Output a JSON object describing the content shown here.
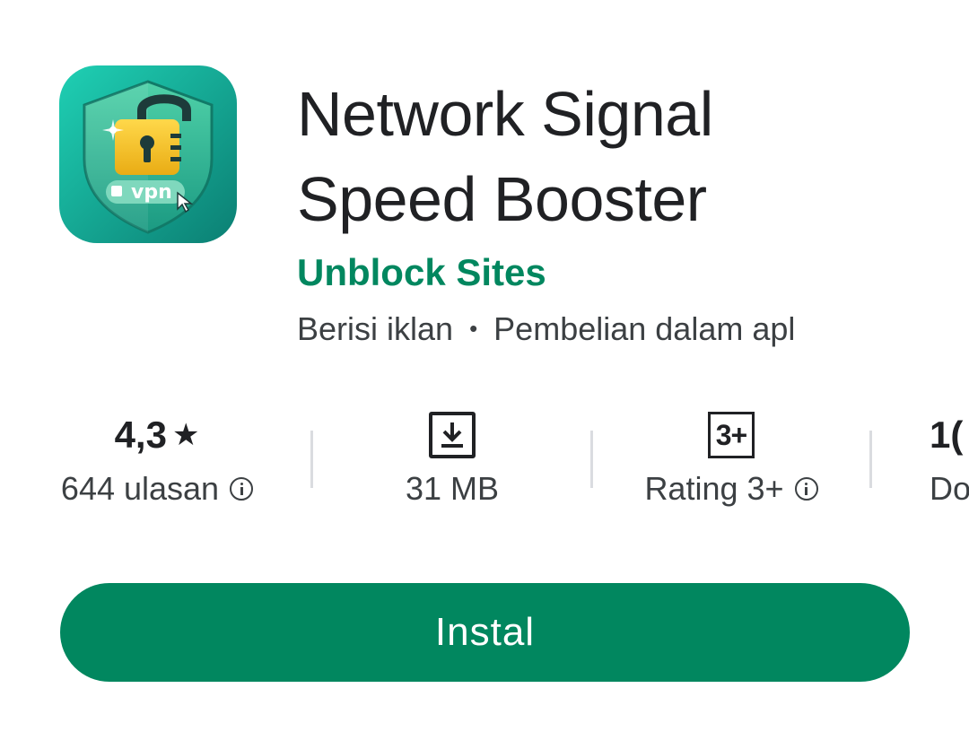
{
  "app": {
    "title_line1": "Network Signal",
    "title_line2": "Speed Booster",
    "developer": "Unblock Sites",
    "contains_ads": "Berisi iklan",
    "separator": "•",
    "in_app_purchases": "Pembelian dalam apl",
    "icon": {
      "name": "vpn-shield-lock-icon",
      "text": "vpn"
    }
  },
  "stats": {
    "rating_value": "4,3",
    "rating_star": "★",
    "reviews_label": "644 ulasan",
    "size_label": "31 MB",
    "content_rating_badge": "3+",
    "content_rating_label": "Rating 3+",
    "downloads_value_partial": "1(",
    "downloads_label_partial": "Do"
  },
  "install": {
    "label": "Instal"
  },
  "colors": {
    "accent": "#01875f",
    "text_primary": "#202124",
    "text_secondary": "#3c4043",
    "divider": "#dadce0",
    "icon_bg_top": "#19c9b0",
    "icon_bg_bottom": "#0d8a7a",
    "lock_yellow": "#f5c320"
  }
}
